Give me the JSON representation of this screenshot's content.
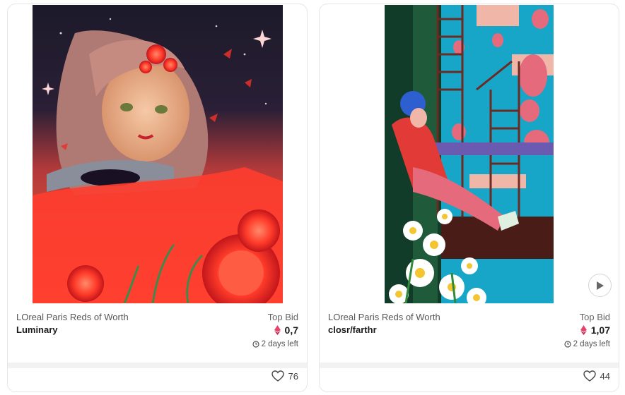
{
  "cards": [
    {
      "collection": "LOreal Paris Reds of Worth",
      "artist": "Luminary",
      "bid_label": "Top Bid",
      "bid_value": "0,7",
      "time_left": "2 days left",
      "likes": "76",
      "media": "image",
      "currency_icon": "ethereum-icon"
    },
    {
      "collection": "LOreal Paris Reds of Worth",
      "artist": "closr/farthr",
      "bid_label": "Top Bid",
      "bid_value": "1,07",
      "time_left": "2 days left",
      "likes": "44",
      "media": "video",
      "currency_icon": "ethereum-icon"
    }
  ],
  "colors": {
    "eth_pink": "#e8416b",
    "card_border": "#e6e6e6",
    "divider": "#f2f2f2"
  }
}
